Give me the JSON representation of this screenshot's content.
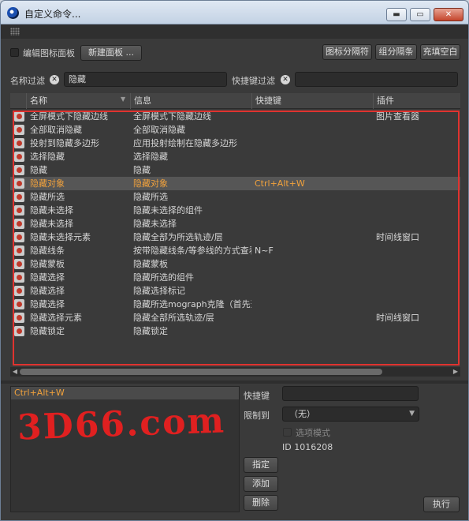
{
  "window": {
    "title": "自定义命令...",
    "min_label": "▬",
    "max_label": "▭",
    "close_label": "✕"
  },
  "toolbar": {
    "edit_icon_panel_label": "编辑图标面板",
    "new_panel_label": "新建面板 ...",
    "icon_separator_label": "图标分隔符",
    "group_separator_label": "组分隔条",
    "fill_blank_label": "充填空白"
  },
  "filters": {
    "name_filter_label": "名称过滤",
    "name_filter_value": "隐藏",
    "shortcut_filter_label": "快捷键过滤",
    "shortcut_filter_value": ""
  },
  "table": {
    "columns": [
      "名称",
      "信息",
      "快捷键",
      "插件"
    ],
    "rows": [
      {
        "name": "全屏模式下隐藏边线",
        "info": "全屏模式下隐藏边线",
        "shortcut": "",
        "plugin": "图片查看器",
        "selected": false
      },
      {
        "name": "全部取消隐藏",
        "info": "全部取消隐藏",
        "shortcut": "",
        "plugin": "",
        "selected": false
      },
      {
        "name": "投射到隐藏多边形",
        "info": "应用投射绘制在隐藏多边形",
        "shortcut": "",
        "plugin": "",
        "selected": false
      },
      {
        "name": "选择隐藏",
        "info": "选择隐藏",
        "shortcut": "",
        "plugin": "",
        "selected": false
      },
      {
        "name": "隐藏",
        "info": "隐藏",
        "shortcut": "",
        "plugin": "",
        "selected": false
      },
      {
        "name": "隐藏对象",
        "info": "隐藏对象",
        "shortcut": "Ctrl+Alt+W",
        "plugin": "",
        "selected": true
      },
      {
        "name": "隐藏所选",
        "info": "隐藏所选",
        "shortcut": "",
        "plugin": "",
        "selected": false
      },
      {
        "name": "隐藏未选择",
        "info": "隐藏未选择的组件",
        "shortcut": "",
        "plugin": "",
        "selected": false
      },
      {
        "name": "隐藏未选择",
        "info": "隐藏未选择",
        "shortcut": "",
        "plugin": "",
        "selected": false
      },
      {
        "name": "隐藏未选择元素",
        "info": "隐藏全部为所选轨迹/层",
        "shortcut": "",
        "plugin": "时间线窗口",
        "selected": false
      },
      {
        "name": "隐藏线条",
        "info": "按带隐藏线条/等参线的方式查看",
        "shortcut": "N~F",
        "plugin": "",
        "selected": false
      },
      {
        "name": "隐藏蒙板",
        "info": "隐藏蒙板",
        "shortcut": "",
        "plugin": "",
        "selected": false
      },
      {
        "name": "隐藏选择",
        "info": "隐藏所选的组件",
        "shortcut": "",
        "plugin": "",
        "selected": false
      },
      {
        "name": "隐藏选择",
        "info": "隐藏选择标记",
        "shortcut": "",
        "plugin": "",
        "selected": false
      },
      {
        "name": "隐藏选择",
        "info": "隐藏所选mograph克隆（首先选择",
        "shortcut": "",
        "plugin": "",
        "selected": false
      },
      {
        "name": "隐藏选择元素",
        "info": "隐藏全部所选轨迹/层",
        "shortcut": "",
        "plugin": "时间线窗口",
        "selected": false
      },
      {
        "name": "隐藏锁定",
        "info": "隐藏锁定",
        "shortcut": "",
        "plugin": "",
        "selected": false
      }
    ]
  },
  "shortcut_list": {
    "items": [
      "Ctrl+Alt+W"
    ],
    "watermark": "3D66.com"
  },
  "details": {
    "shortcut_label": "快捷键",
    "shortcut_value": "",
    "restrict_label": "限制到",
    "restrict_value": "（无）",
    "option_mode_label": "选项模式",
    "id_text": "ID 1016208",
    "assign_label": "指定",
    "add_label": "添加",
    "delete_label": "删除",
    "execute_label": "执行"
  },
  "colors": {
    "highlight": "#f2a23c",
    "annotation_border": "#e0332f"
  }
}
